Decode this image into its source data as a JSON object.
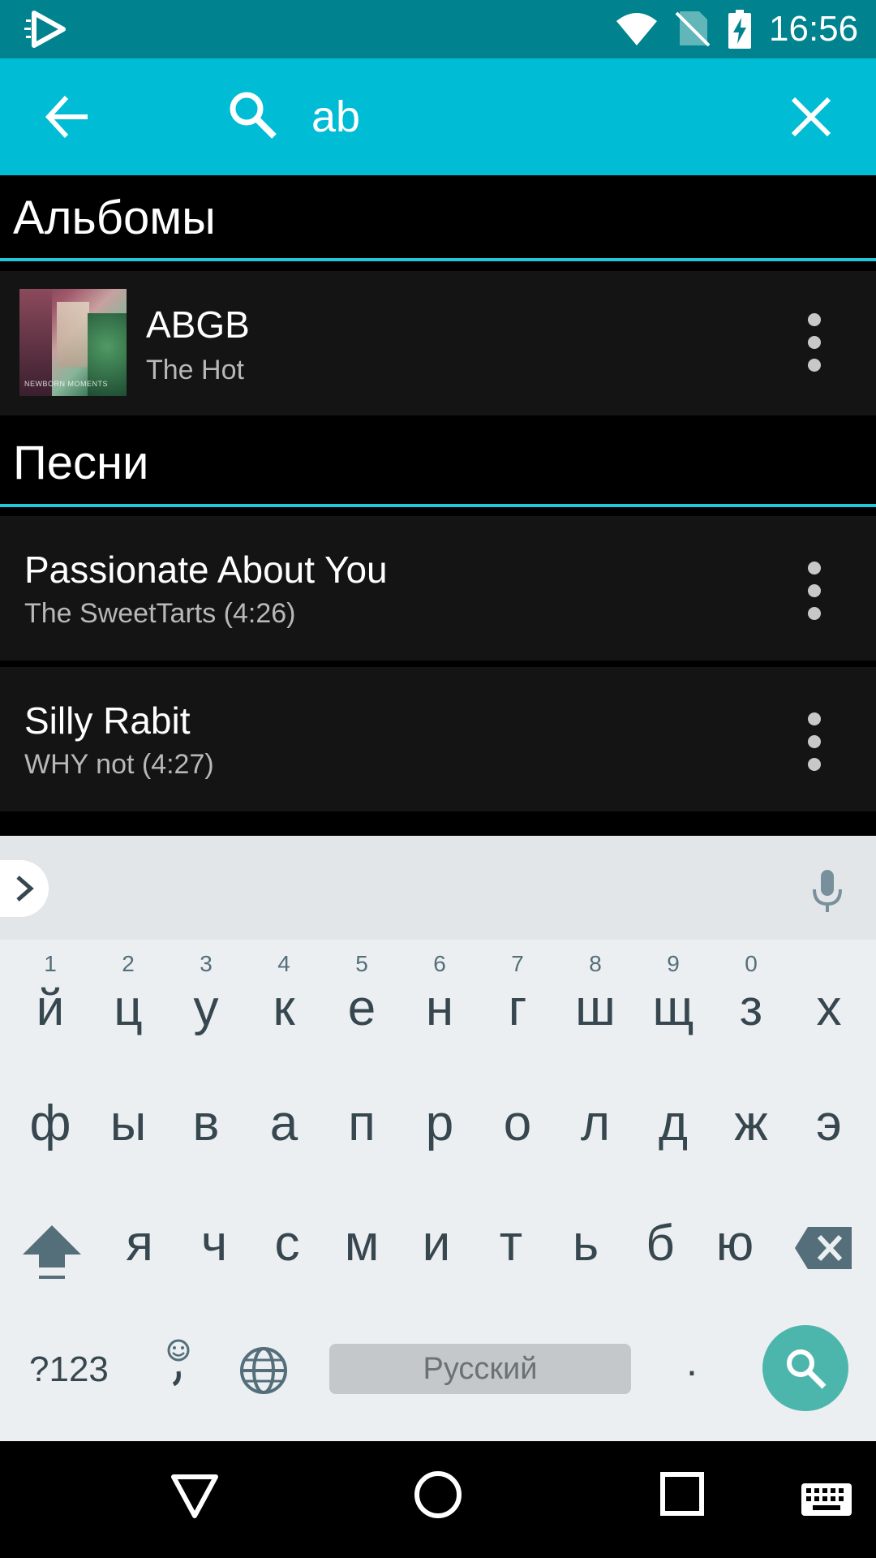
{
  "status_bar": {
    "time": "16:56"
  },
  "search": {
    "query": "ab",
    "icons": [
      "arrow-back-icon",
      "search-icon",
      "close-icon"
    ]
  },
  "albums": {
    "header": "Альбомы",
    "items": [
      {
        "title": "ABGB",
        "subtitle": "The Hot",
        "cover_text": "NEWBORN MOMENTS"
      }
    ]
  },
  "songs": {
    "header": "Песни",
    "items": [
      {
        "title": "Passionate About You",
        "subtitle": "The SweetTarts (4:26)"
      },
      {
        "title": "Silly Rabit",
        "subtitle": "WHY not (4:27)"
      }
    ]
  },
  "keyboard": {
    "row1": [
      {
        "k": "й",
        "h": "1"
      },
      {
        "k": "ц",
        "h": "2"
      },
      {
        "k": "у",
        "h": "3"
      },
      {
        "k": "к",
        "h": "4"
      },
      {
        "k": "е",
        "h": "5"
      },
      {
        "k": "н",
        "h": "6"
      },
      {
        "k": "г",
        "h": "7"
      },
      {
        "k": "ш",
        "h": "8"
      },
      {
        "k": "щ",
        "h": "9"
      },
      {
        "k": "з",
        "h": "0"
      },
      {
        "k": "х",
        "h": ""
      }
    ],
    "row2": [
      "ф",
      "ы",
      "в",
      "а",
      "п",
      "р",
      "о",
      "л",
      "д",
      "ж",
      "э"
    ],
    "row3": [
      "я",
      "ч",
      "с",
      "м",
      "и",
      "т",
      "ь",
      "б",
      "ю"
    ],
    "symbols_label": "?123",
    "period_label": ".",
    "space_label": "Русский",
    "accent_color": "#4db6ac"
  },
  "colors": {
    "status_bar": "#00838f",
    "search_bar": "#00bcd4",
    "divider": "#26c6da"
  }
}
